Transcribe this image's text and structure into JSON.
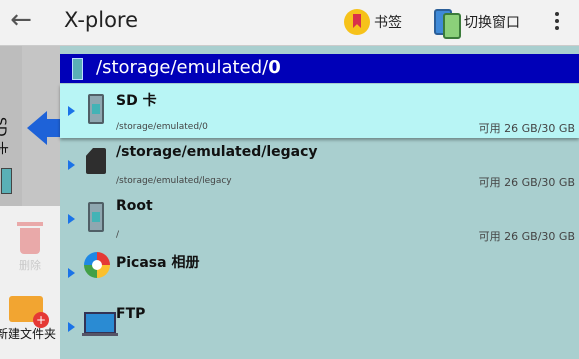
{
  "app": {
    "title": "X-plore"
  },
  "toolbar": {
    "bookmark_label": "书签",
    "switch_label": "切换窗口"
  },
  "side": {
    "tab_label": "SD 卡",
    "delete_label": "删除",
    "new_folder_label": "新建文件夹"
  },
  "path": {
    "prefix": "/storage/emulated/",
    "current": "0"
  },
  "items": [
    {
      "name": "SD 卡",
      "path": "/storage/emulated/0",
      "space": "可用 26 GB/30 GB",
      "icon": "phone-storage-icon",
      "selected": true
    },
    {
      "name": "/storage/emulated/legacy",
      "path": "/storage/emulated/legacy",
      "space": "可用 26 GB/30 GB",
      "icon": "sd-card-icon"
    },
    {
      "name": "Root",
      "path": "/",
      "space": "可用 26 GB/30 GB",
      "icon": "phone-storage-icon"
    },
    {
      "name": "Picasa 相册",
      "icon": "picasa-icon"
    },
    {
      "name": "FTP",
      "icon": "ftp-monitor-icon"
    }
  ],
  "colors": {
    "path_bar": "#0000b8",
    "selected_row": "#b8f5f5",
    "list_bg": "#a9cfcf",
    "accent": "#1e62d8"
  }
}
